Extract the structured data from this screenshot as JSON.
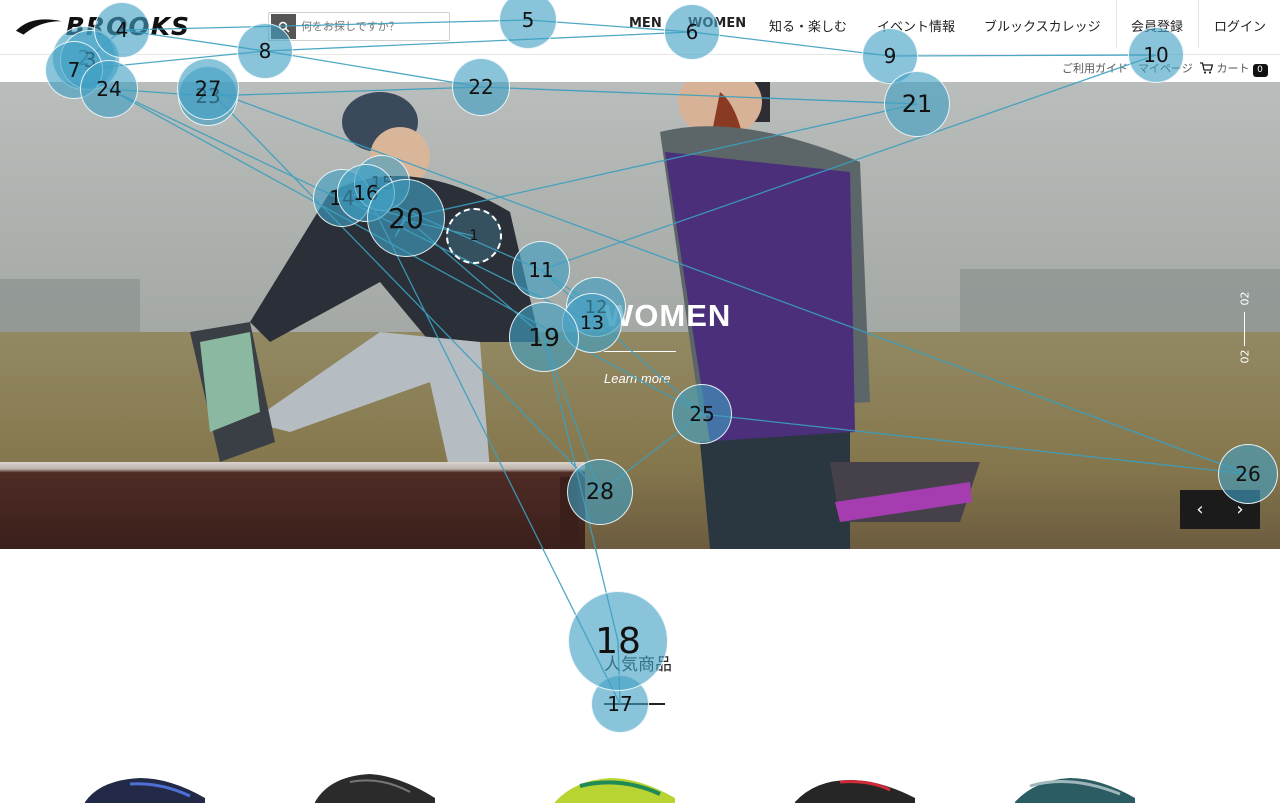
{
  "header": {
    "logo_text": "BROOKS",
    "search_placeholder": "何をお探しですか？",
    "nav": {
      "men": "MEN",
      "women": "WOMEN",
      "learn": "知る・楽しむ",
      "events": "イベント情報",
      "college": "ブルックスカレッジ",
      "register": "会員登録",
      "login": "ログイン"
    },
    "sub_nav": {
      "guide": "ご利用ガイド",
      "mypage": "マイページ",
      "cart_label": "カート",
      "cart_count": "0"
    }
  },
  "hero": {
    "title": "WOMEN",
    "link": "Learn more",
    "pager_current": "02",
    "pager_total": "02",
    "prev_glyph": "‹",
    "next_glyph": "›"
  },
  "popular": {
    "title": "人気商品"
  },
  "hotspots": {
    "color": "#40a0c4",
    "labels": [
      "1",
      "2",
      "3",
      "4",
      "5",
      "6",
      "7",
      "8",
      "9",
      "10",
      "11",
      "12",
      "13",
      "14",
      "15",
      "16",
      "17",
      "18",
      "19",
      "20",
      "21",
      "22",
      "23",
      "24",
      "25",
      "26",
      "27",
      "28"
    ]
  }
}
